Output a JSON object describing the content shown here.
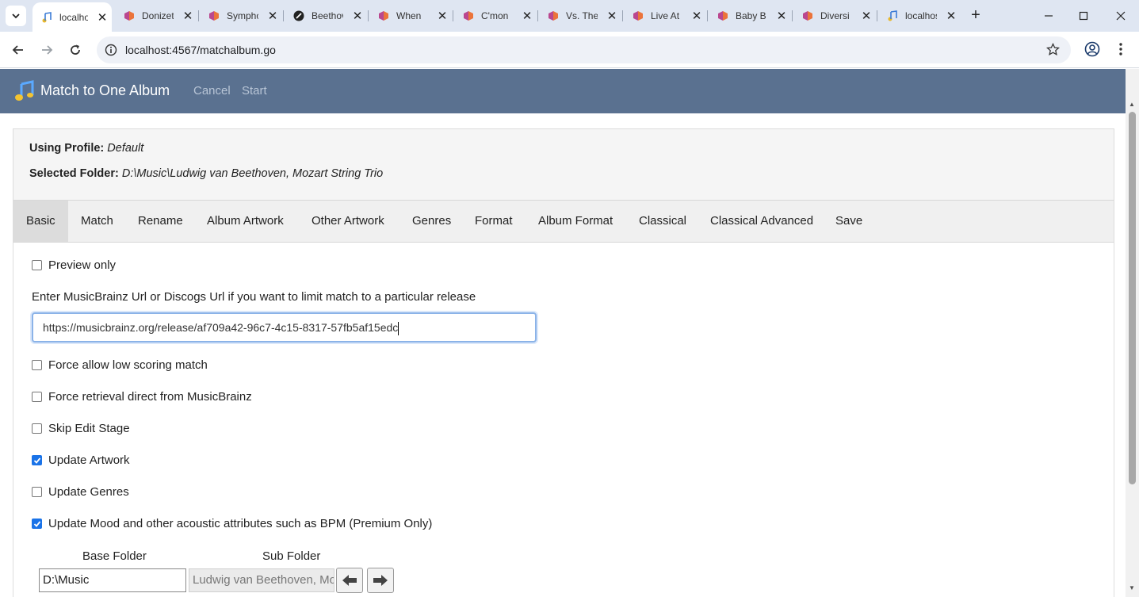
{
  "browser": {
    "tabs": [
      {
        "title": "localhost",
        "favicon": "music-note-icon",
        "active": true
      },
      {
        "title": "Donizetti",
        "favicon": "musicbrainz-icon"
      },
      {
        "title": "Symphony",
        "favicon": "musicbrainz-icon"
      },
      {
        "title": "Beethoven",
        "favicon": "discogs-icon"
      },
      {
        "title": "When",
        "favicon": "musicbrainz-icon"
      },
      {
        "title": "C'mon",
        "favicon": "musicbrainz-icon"
      },
      {
        "title": "Vs. The",
        "favicon": "musicbrainz-icon"
      },
      {
        "title": "Live At",
        "favicon": "musicbrainz-icon"
      },
      {
        "title": "Baby B",
        "favicon": "musicbrainz-icon"
      },
      {
        "title": "Diversi",
        "favicon": "musicbrainz-icon"
      },
      {
        "title": "localhost",
        "favicon": "music-note-icon"
      }
    ],
    "address": "localhost:4567/matchalbum.go"
  },
  "header": {
    "title": "Match to One Album",
    "cancel_label": "Cancel",
    "start_label": "Start"
  },
  "info": {
    "profile_label": "Using Profile:",
    "profile_value": "Default",
    "folder_label": "Selected Folder:",
    "folder_value": "D:\\Music\\Ludwig van Beethoven, Mozart String Trio"
  },
  "tabs": [
    "Basic",
    "Match",
    "Rename",
    "Album Artwork",
    "Other Artwork",
    "Genres",
    "Format",
    "Album Format",
    "Classical",
    "Classical Advanced",
    "Save"
  ],
  "form": {
    "preview_only": {
      "label": "Preview only",
      "checked": false
    },
    "url_label": "Enter MusicBrainz Url or Discogs Url if you want to limit match to a particular release",
    "url_value": "https://musicbrainz.org/release/af709a42-96c7-4c15-8317-57fb5af15edc",
    "options": [
      {
        "label": "Force allow low scoring match",
        "checked": false
      },
      {
        "label": "Force retrieval direct from MusicBrainz",
        "checked": false
      },
      {
        "label": "Skip Edit Stage",
        "checked": false
      },
      {
        "label": "Update Artwork",
        "checked": true
      },
      {
        "label": "Update Genres",
        "checked": false
      },
      {
        "label": "Update Mood and other acoustic attributes such as BPM (Premium Only)",
        "checked": true
      }
    ],
    "base_folder_label": "Base Folder",
    "sub_folder_label": "Sub Folder",
    "base_folder_value": "D:\\Music",
    "sub_folder_value": "Ludwig van Beethoven, Mozart String Trio"
  },
  "colors": {
    "header_bg": "#5a7190",
    "checkbox_checked": "#1a73e8"
  }
}
